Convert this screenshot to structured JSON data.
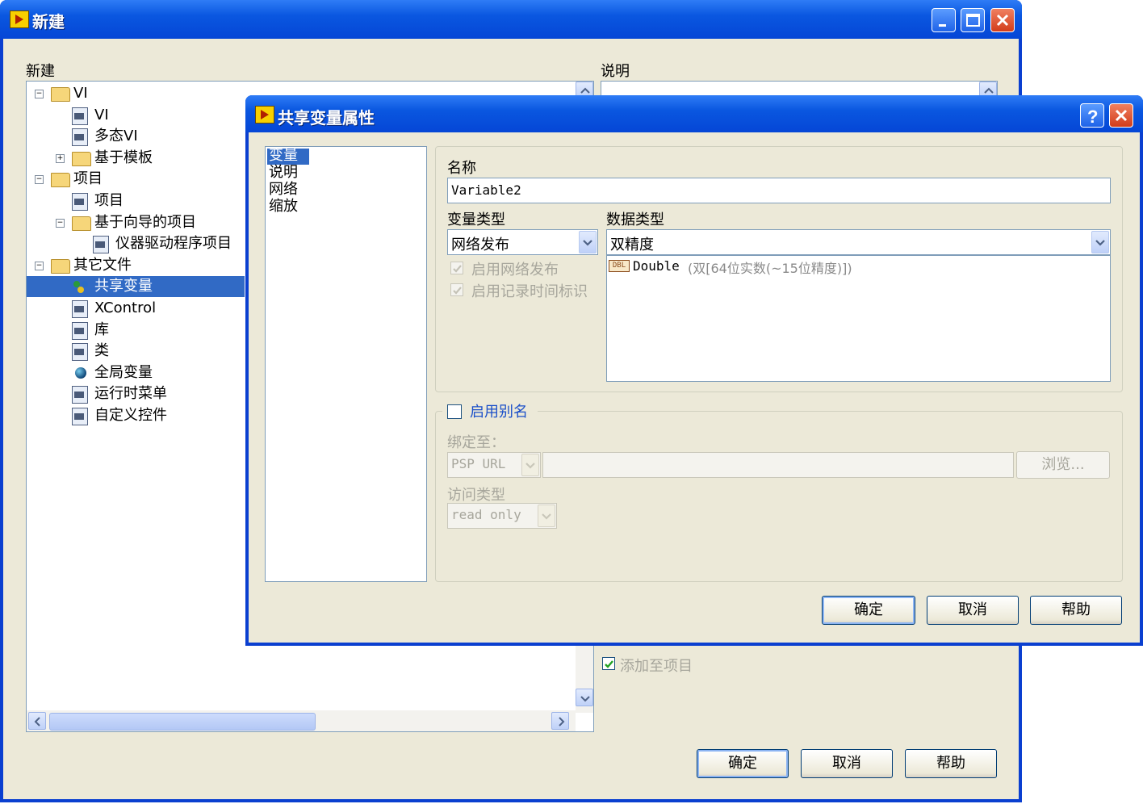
{
  "main_window": {
    "title": "新建",
    "new_label": "新建",
    "description_label": "说明",
    "tree": [
      {
        "label": "VI",
        "level": 0,
        "type": "folder",
        "expanded": true
      },
      {
        "label": "VI",
        "level": 1,
        "type": "file"
      },
      {
        "label": "多态VI",
        "level": 1,
        "type": "file"
      },
      {
        "label": "基于模板",
        "level": 1,
        "type": "folder",
        "expanded": false
      },
      {
        "label": "项目",
        "level": 0,
        "type": "folder",
        "expanded": true
      },
      {
        "label": "项目",
        "level": 1,
        "type": "file"
      },
      {
        "label": "基于向导的项目",
        "level": 1,
        "type": "folder",
        "expanded": true
      },
      {
        "label": "仪器驱动程序项目",
        "level": 2,
        "type": "file"
      },
      {
        "label": "其它文件",
        "level": 0,
        "type": "folder",
        "expanded": true
      },
      {
        "label": "共享变量",
        "level": 1,
        "type": "shared",
        "selected": true
      },
      {
        "label": "XControl",
        "level": 1,
        "type": "file"
      },
      {
        "label": "库",
        "level": 1,
        "type": "file"
      },
      {
        "label": "类",
        "level": 1,
        "type": "file"
      },
      {
        "label": "全局变量",
        "level": 1,
        "type": "dot"
      },
      {
        "label": "运行时菜单",
        "level": 1,
        "type": "file"
      },
      {
        "label": "自定义控件",
        "level": 1,
        "type": "file"
      }
    ],
    "add_to_project_label": "添加至项目",
    "add_to_project_checked": true,
    "ok_label": "确定",
    "cancel_label": "取消",
    "help_label": "帮助"
  },
  "dialog": {
    "title": "共享变量属性",
    "categories": [
      "变量",
      "说明",
      "网络",
      "缩放"
    ],
    "selected_category": "变量",
    "name_label": "名称",
    "name_value": "Variable2",
    "variable_type_label": "变量类型",
    "variable_type_value": "网络发布",
    "data_type_label": "数据类型",
    "data_type_value": "双精度",
    "enable_network_publish_label": "启用网络发布",
    "enable_timestamp_label": "启用记录时间标识",
    "data_type_detail_badge": "DBL",
    "data_type_detail_name": "Double",
    "data_type_detail_desc": "(双[64位实数(~15位精度)])",
    "enable_alias_label": "启用别名",
    "bind_to_label": "绑定至：",
    "bind_combo_value": "PSP URL",
    "browse_label": "浏览...",
    "access_type_label": "访问类型",
    "access_type_value": "read only",
    "ok_label": "确定",
    "cancel_label": "取消",
    "help_label": "帮助"
  }
}
